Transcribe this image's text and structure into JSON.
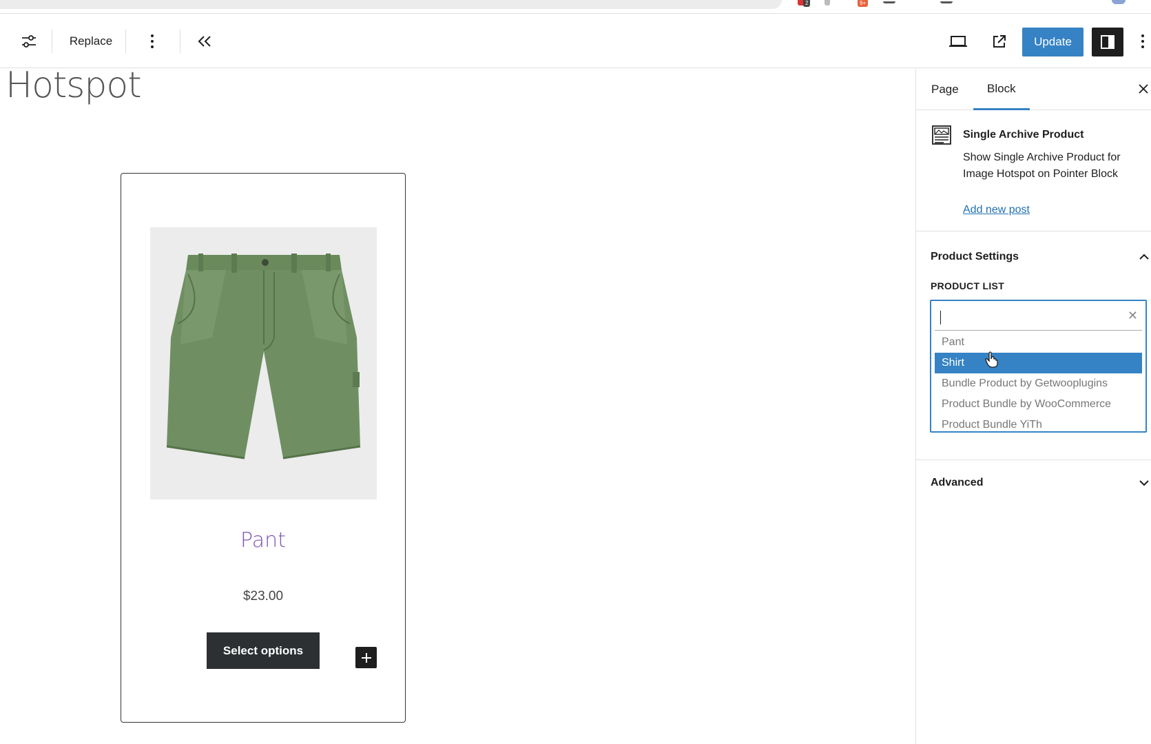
{
  "toolbar": {
    "replace_label": "Replace",
    "update_label": "Update"
  },
  "canvas": {
    "page_title": "Hotspot",
    "product": {
      "name": "Pant",
      "price": "$23.00",
      "button_label": "Select options"
    }
  },
  "sidebar": {
    "tabs": [
      {
        "label": "Page",
        "active": false
      },
      {
        "label": "Block",
        "active": true
      }
    ],
    "block": {
      "title": "Single Archive Product",
      "description": "Show Single Archive Product for Image Hotspot on Pointer Block",
      "link": "Add new post"
    },
    "product_settings": {
      "title": "Product Settings",
      "field_label": "PRODUCT LIST",
      "search_value": "",
      "options": [
        "Pant",
        "Shirt",
        "Bundle Product by Getwooplugins",
        "Product Bundle by WooCommerce",
        "Product Bundle YiTh"
      ],
      "selected_option": "Shirt"
    },
    "advanced": {
      "title": "Advanced"
    }
  },
  "browser": {
    "extension_badges": [
      "2",
      "9+"
    ]
  },
  "colors": {
    "accent": "#3582c4",
    "dark": "#1e1e1e",
    "product_name": "#7f54b3",
    "pant_green": "#6f8f62"
  }
}
